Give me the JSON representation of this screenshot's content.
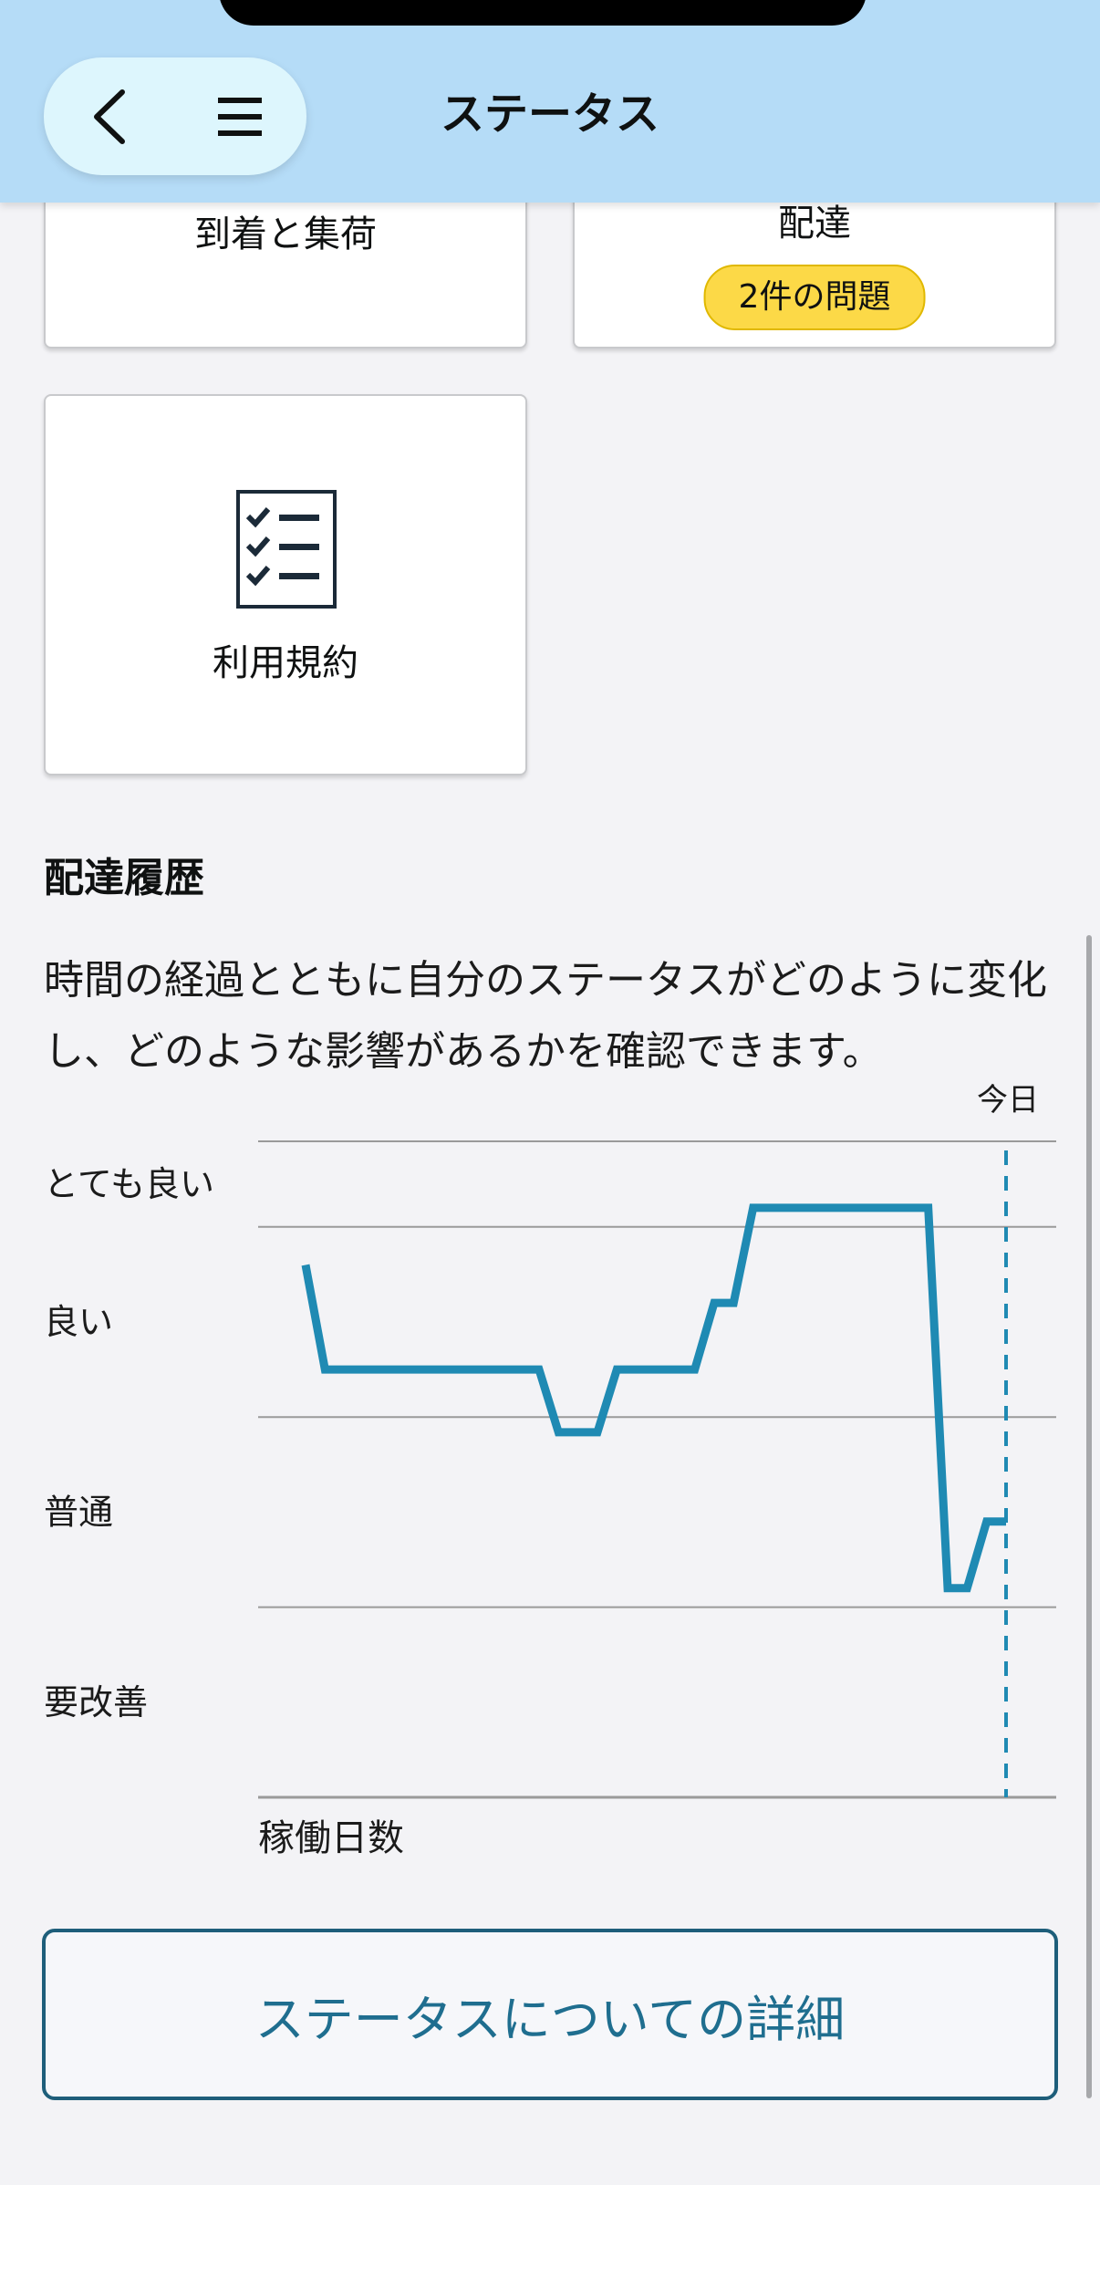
{
  "header": {
    "title": "ステータス"
  },
  "cards": {
    "arrival": {
      "label": "到着と集荷"
    },
    "delivery": {
      "label": "配達",
      "badge": "2件の問題"
    },
    "terms": {
      "label": "利用規約"
    }
  },
  "history": {
    "title": "配達履歴",
    "description": "時間の経過とともに自分のステータスがどのように変化し、どのような影響があるかを確認できます。"
  },
  "chart_data": {
    "type": "line",
    "xlabel": "稼働日数",
    "y_levels": [
      "とても良い",
      "良い",
      "普通",
      "要改善"
    ],
    "today_label": "今日",
    "series": [
      {
        "color": "#1f8ab3",
        "points": [
          [
            0,
            3.8
          ],
          [
            1,
            3.25
          ],
          [
            2,
            3.25
          ],
          [
            3,
            3.25
          ],
          [
            4,
            3.25
          ],
          [
            5,
            3.25
          ],
          [
            6,
            3.25
          ],
          [
            7,
            3.25
          ],
          [
            8,
            3.25
          ],
          [
            9,
            3.25
          ],
          [
            10,
            3.25
          ],
          [
            11,
            3.25
          ],
          [
            12,
            3.25
          ],
          [
            13,
            2.92
          ],
          [
            14,
            2.92
          ],
          [
            15,
            2.92
          ],
          [
            16,
            3.25
          ],
          [
            17,
            3.25
          ],
          [
            18,
            3.25
          ],
          [
            19,
            3.25
          ],
          [
            20,
            3.25
          ],
          [
            21,
            3.6
          ],
          [
            22,
            3.6
          ],
          [
            23,
            4.1
          ],
          [
            24,
            4.1
          ],
          [
            25,
            4.1
          ],
          [
            26,
            4.1
          ],
          [
            27,
            4.1
          ],
          [
            28,
            4.1
          ],
          [
            29,
            4.1
          ],
          [
            30,
            4.1
          ],
          [
            31,
            4.1
          ],
          [
            32,
            4.1
          ],
          [
            33,
            2.1
          ],
          [
            34,
            2.1
          ],
          [
            35,
            2.45
          ],
          [
            36,
            2.45
          ]
        ]
      }
    ],
    "ylim": [
      1,
      4.45
    ],
    "grid": true
  },
  "details_button": {
    "label": "ステータスについての詳細"
  }
}
